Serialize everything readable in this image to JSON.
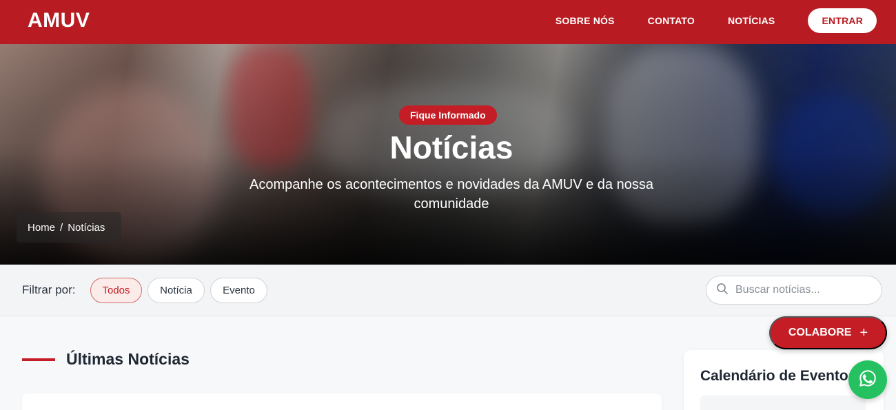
{
  "header": {
    "logo": "AMUV",
    "nav": [
      "SOBRE NÓS",
      "CONTATO",
      "NOTÍCIAS"
    ],
    "login_label": "ENTRAR"
  },
  "hero": {
    "kicker": "Fique Informado",
    "title": "Notícias",
    "subtitle": "Acompanhe os acontecimentos e novidades da AMUV e da nossa comunidade",
    "breadcrumb": [
      "Home",
      "Notícias"
    ],
    "breadcrumb_separator": "/"
  },
  "filters": {
    "label": "Filtrar por:",
    "options": [
      "Todos",
      "Notícia",
      "Evento"
    ],
    "selected": "Todos",
    "search_placeholder": "Buscar notícias..."
  },
  "main": {
    "section_title": "Últimas Notícias"
  },
  "sidebar": {
    "calendar_title": "Calendário de Eventos"
  },
  "floating": {
    "colabore_label": "COLABORE",
    "colabore_icon": "plus-icon",
    "whatsapp_icon": "whatsapp-icon"
  },
  "colors": {
    "brand": "#b81b21",
    "accent": "#c41d25",
    "whatsapp": "#25c060"
  }
}
